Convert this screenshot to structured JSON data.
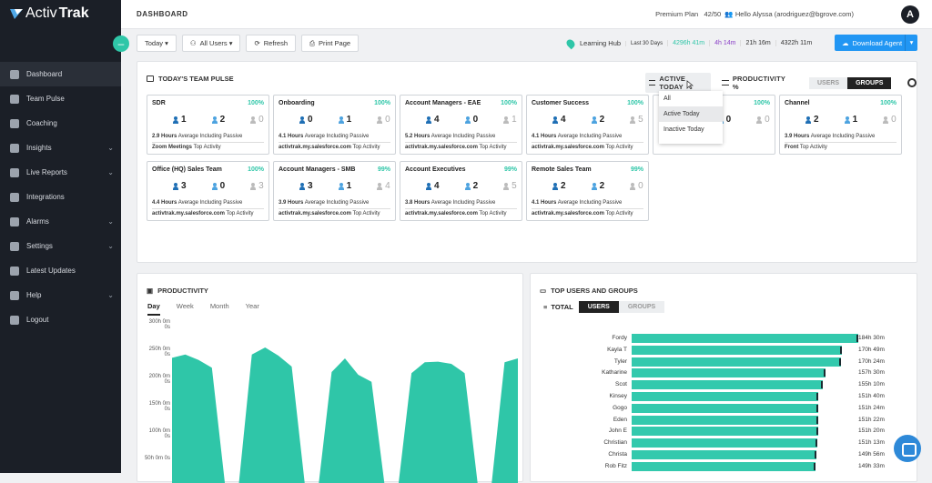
{
  "app": {
    "logo_a": "Activ",
    "logo_b": "Trak"
  },
  "sidebar": {
    "items": [
      {
        "label": "Dashboard",
        "icon": "dashboard-icon",
        "chevron": false
      },
      {
        "label": "Team Pulse",
        "icon": "team-pulse-icon",
        "chevron": false
      },
      {
        "label": "Coaching",
        "icon": "coaching-icon",
        "chevron": false
      },
      {
        "label": "Insights",
        "icon": "insights-icon",
        "chevron": true
      },
      {
        "label": "Live Reports",
        "icon": "reports-icon",
        "chevron": true
      },
      {
        "label": "Integrations",
        "icon": "integrations-icon",
        "chevron": false
      },
      {
        "label": "Alarms",
        "icon": "bell-icon",
        "chevron": true
      },
      {
        "label": "Settings",
        "icon": "gear-icon",
        "chevron": true
      },
      {
        "label": "Latest Updates",
        "icon": "updates-icon",
        "chevron": false
      },
      {
        "label": "Help",
        "icon": "help-icon",
        "chevron": true
      },
      {
        "label": "Logout",
        "icon": "logout-icon",
        "chevron": false
      }
    ]
  },
  "header": {
    "title": "DASHBOARD",
    "plan": "Premium Plan",
    "seats": "42/50",
    "greeting": "Hello Alyssa (arodriguez@bgrove.com)",
    "avatar": "A"
  },
  "toolbar": {
    "today": "Today ▾",
    "users": "All Users ▾",
    "refresh": "Refresh",
    "print": "Print Page",
    "hub": "Learning Hub",
    "last30": "Last 30 Days",
    "v1": "4296h 41m",
    "v2": "4h 14m",
    "v3": "21h 16m",
    "v4": "4322h 11m",
    "download": "Download Agent"
  },
  "pulse": {
    "title": "TODAY'S TEAM PULSE",
    "filter_active": "ACTIVE TODAY",
    "filter_prod": "PRODUCTIVITY %",
    "toggle_users": "USERS",
    "toggle_groups": "GROUPS",
    "dropdown": [
      "All",
      "Active Today",
      "Inactive Today"
    ],
    "cards": [
      {
        "name": "SDR",
        "pct": "100%",
        "a": "1",
        "b": "2",
        "c": "0",
        "hours": "2.9 Hours",
        "top": "Zoom Meetings"
      },
      {
        "name": "Onboarding",
        "pct": "100%",
        "a": "0",
        "b": "1",
        "c": "0",
        "hours": "4.1 Hours",
        "top": "activtrak.my.salesforce.com"
      },
      {
        "name": "Account Managers - EAE",
        "pct": "100%",
        "a": "4",
        "b": "0",
        "c": "1",
        "hours": "5.2 Hours",
        "top": "activtrak.my.salesforce.com"
      },
      {
        "name": "Customer Success",
        "pct": "100%",
        "a": "4",
        "b": "2",
        "c": "5",
        "hours": "4.1 Hours",
        "top": "activtrak.my.salesforce.com"
      },
      {
        "name": "",
        "pct": "100%",
        "a": "0",
        "b": "0",
        "c": "0",
        "hours": "",
        "top": ""
      },
      {
        "name": "Channel",
        "pct": "100%",
        "a": "2",
        "b": "1",
        "c": "0",
        "hours": "3.9 Hours",
        "top": "Front"
      },
      {
        "name": "Office (HQ) Sales Team",
        "pct": "100%",
        "a": "3",
        "b": "0",
        "c": "3",
        "hours": "4.4 Hours",
        "top": "activtrak.my.salesforce.com"
      },
      {
        "name": "Account Managers - SMB",
        "pct": "99%",
        "a": "3",
        "b": "1",
        "c": "4",
        "hours": "3.9 Hours",
        "top": "activtrak.my.salesforce.com"
      },
      {
        "name": "Account Executives",
        "pct": "99%",
        "a": "4",
        "b": "2",
        "c": "5",
        "hours": "3.8 Hours",
        "top": "activtrak.my.salesforce.com"
      },
      {
        "name": "Remote Sales Team",
        "pct": "99%",
        "a": "2",
        "b": "2",
        "c": "0",
        "hours": "4.1 Hours",
        "top": "activtrak.my.salesforce.com"
      }
    ],
    "hours_suffix": "Average Including Passive",
    "top_suffix": "Top Activity"
  },
  "productivity": {
    "title": "PRODUCTIVITY",
    "tabs": [
      "Day",
      "Week",
      "Month",
      "Year"
    ],
    "chart_data": {
      "type": "area",
      "yticks": [
        "300h 0m 0s",
        "250h 0m 0s",
        "200h 0m 0s",
        "150h 0m 0s",
        "100h 0m 0s",
        "50h 0m 0s"
      ],
      "ylim": [
        0,
        300
      ],
      "series": [
        {
          "values": [
            236,
            242,
            232,
            218,
            0,
            0,
            242,
            255,
            240,
            220,
            0,
            0,
            210,
            235,
            205,
            192,
            0,
            0,
            208,
            228,
            229,
            225,
            208,
            0,
            0,
            228,
            235
          ]
        }
      ]
    }
  },
  "top_users": {
    "title": "TOP USERS AND GROUPS",
    "total": "TOTAL",
    "toggle_users": "USERS",
    "toggle_groups": "GROUPS",
    "chart_data": {
      "type": "bar",
      "categories": [
        "Fordy",
        "Kayla T",
        "Tyler",
        "Katharine",
        "Scot",
        "Kinsey",
        "Gogo",
        "Eden",
        "John E",
        "Christian",
        "Christa",
        "Rob Fitz"
      ],
      "values": [
        184.5,
        170.82,
        170.4,
        157.5,
        155.17,
        151.67,
        151.4,
        151.37,
        151.33,
        151.22,
        149.93,
        149.55
      ],
      "labels": [
        "184h 30m",
        "170h 49m",
        "170h 24m",
        "157h 30m",
        "155h 10m",
        "151h 40m",
        "151h 24m",
        "151h 22m",
        "151h 20m",
        "151h 13m",
        "149h 56m",
        "149h 33m"
      ],
      "xlim": [
        0,
        185
      ]
    }
  },
  "colors": {
    "accent": "#2fc6a8",
    "bar": "#33c9ad",
    "blue": "#2196f3"
  }
}
